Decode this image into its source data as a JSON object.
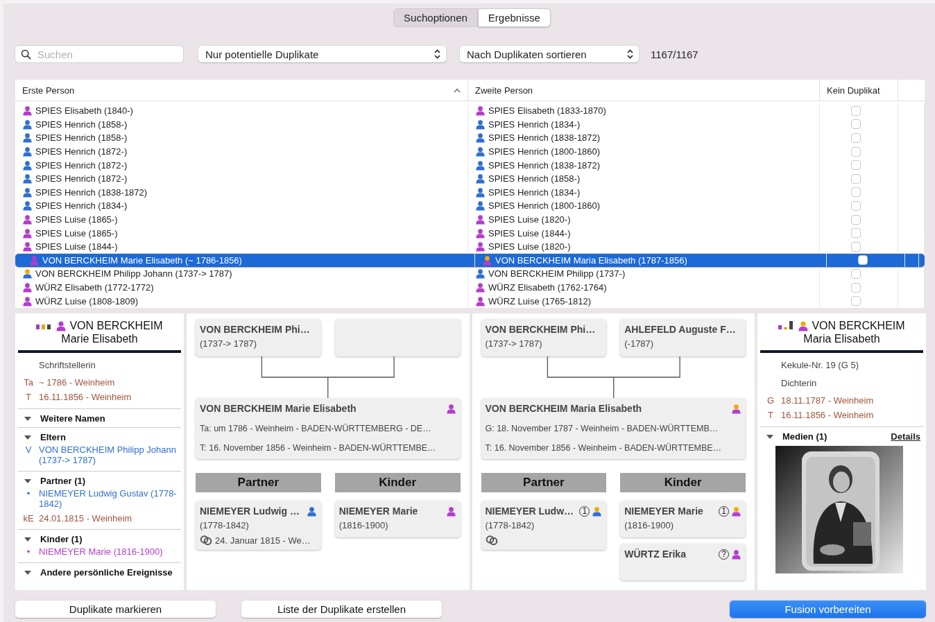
{
  "view_tabs": [
    {
      "label": "Suchoptionen",
      "selected": false
    },
    {
      "label": "Ergebnisse",
      "selected": true
    }
  ],
  "toolbar": {
    "search": {
      "placeholder": "Suchen"
    },
    "filter": "Nur potentielle Duplikate",
    "sort": "Nach Duplikaten sortieren",
    "count": "1167/1167"
  },
  "table": {
    "columns": [
      {
        "label": "Erste Person",
        "sorted": true
      },
      {
        "label": "Zweite Person",
        "sorted": false
      },
      {
        "label": "Kein Duplikat",
        "sorted": false
      }
    ],
    "rows": [
      {
        "first": {
          "text": "SPIES Elisabeth (1840-)",
          "female": true,
          "highlighted": false
        },
        "second": {
          "text": "SPIES Elisabeth (1833-1870)",
          "female": true,
          "highlighted": false
        },
        "checked": false,
        "selected": false
      },
      {
        "first": {
          "text": "SPIES Henrich (1858-)",
          "female": false,
          "highlighted": false
        },
        "second": {
          "text": "SPIES Henrich (1834-)",
          "female": false,
          "highlighted": false
        },
        "checked": false,
        "selected": false
      },
      {
        "first": {
          "text": "SPIES Henrich (1858-)",
          "female": false,
          "highlighted": false
        },
        "second": {
          "text": "SPIES Henrich (1838-1872)",
          "female": false,
          "highlighted": false
        },
        "checked": false,
        "selected": false
      },
      {
        "first": {
          "text": "SPIES Henrich (1872-)",
          "female": false,
          "highlighted": false
        },
        "second": {
          "text": "SPIES Henrich (1800-1860)",
          "female": false,
          "highlighted": false
        },
        "checked": false,
        "selected": false
      },
      {
        "first": {
          "text": "SPIES Henrich (1872-)",
          "female": false,
          "highlighted": false
        },
        "second": {
          "text": "SPIES Henrich (1838-1872)",
          "female": false,
          "highlighted": false
        },
        "checked": false,
        "selected": false
      },
      {
        "first": {
          "text": "SPIES Henrich (1872-)",
          "female": false,
          "highlighted": false
        },
        "second": {
          "text": "SPIES Henrich (1858-)",
          "female": false,
          "highlighted": false
        },
        "checked": false,
        "selected": false
      },
      {
        "first": {
          "text": "SPIES Henrich (1838-1872)",
          "female": false,
          "highlighted": false
        },
        "second": {
          "text": "SPIES Henrich (1834-)",
          "female": false,
          "highlighted": false
        },
        "checked": false,
        "selected": false
      },
      {
        "first": {
          "text": "SPIES Henrich (1834-)",
          "female": false,
          "highlighted": false
        },
        "second": {
          "text": "SPIES Henrich (1800-1860)",
          "female": false,
          "highlighted": false
        },
        "checked": false,
        "selected": false
      },
      {
        "first": {
          "text": "SPIES Luise (1865-)",
          "female": true,
          "highlighted": false
        },
        "second": {
          "text": "SPIES Luise (1820-)",
          "female": true,
          "highlighted": false
        },
        "checked": false,
        "selected": false
      },
      {
        "first": {
          "text": "SPIES Luise (1865-)",
          "female": true,
          "highlighted": false
        },
        "second": {
          "text": "SPIES Luise (1844-)",
          "female": true,
          "highlighted": false
        },
        "checked": false,
        "selected": false
      },
      {
        "first": {
          "text": "SPIES Luise (1844-)",
          "female": true,
          "highlighted": false
        },
        "second": {
          "text": "SPIES Luise (1820-)",
          "female": true,
          "highlighted": false
        },
        "checked": false,
        "selected": false
      },
      {
        "first": {
          "text": "VON BERCKHEIM Marie Elisabeth (~ 1786-1856)",
          "female": true,
          "highlighted": false
        },
        "second": {
          "text": "VON BERCKHEIM Maria Elisabeth (1787-1856)",
          "female": true,
          "highlighted": true
        },
        "checked": false,
        "selected": true
      },
      {
        "first": {
          "text": "VON BERCKHEIM Philipp Johann (1737-> 1787)",
          "female": false,
          "highlighted": true
        },
        "second": {
          "text": "VON BERCKHEIM Philipp (1737-)",
          "female": false,
          "highlighted": false
        },
        "checked": false,
        "selected": false
      },
      {
        "first": {
          "text": "WÜRZ Elisabeth (1772-1772)",
          "female": true,
          "highlighted": false
        },
        "second": {
          "text": "WÜRZ Elisabeth (1762-1764)",
          "female": true,
          "highlighted": false
        },
        "checked": false,
        "selected": false
      },
      {
        "first": {
          "text": "WÜRZ Luise (1808-1809)",
          "female": true,
          "highlighted": false
        },
        "second": {
          "text": "WÜRZ Luise (1765-1812)",
          "female": true,
          "highlighted": false
        },
        "checked": false,
        "selected": false
      }
    ]
  },
  "left_details": {
    "kind": "squares",
    "person": {
      "surname": "VON BERCKHEIM",
      "given": "Marie Elisabeth",
      "female": true,
      "highlighted": false
    },
    "facts": [
      {
        "kind": "note",
        "text": "Schriftstellerin"
      },
      {
        "kind": "event",
        "tag": "Ta",
        "text": "~ 1786 - Weinheim"
      },
      {
        "kind": "event",
        "tag": "T",
        "text": "16.11.1856 - Weinheim"
      }
    ],
    "sections": [
      {
        "title": "Weitere Namen",
        "expanded": true
      },
      {
        "title": "Eltern",
        "expanded": true,
        "items": [
          {
            "kind": "link",
            "tag": "V",
            "text": "VON BERCKHEIM Philipp Johann (1737-> 1787)",
            "female": false
          }
        ]
      },
      {
        "title": "Partner (1)",
        "expanded": true,
        "items": [
          {
            "kind": "link",
            "tag": "•",
            "text": "NIEMEYER Ludwig Gustav (1778-1842)",
            "female": false
          },
          {
            "kind": "event",
            "tag": "kE",
            "text": "24.01.1815 - Weinheim"
          }
        ]
      },
      {
        "title": "Kinder (1)",
        "expanded": true,
        "items": [
          {
            "kind": "link",
            "tag": "•",
            "text": "NIEMEYER Marie (1816-1900)",
            "female": true
          }
        ]
      },
      {
        "title": "Andere persönliche Ereignisse",
        "expanded": true
      }
    ]
  },
  "left_tree": {
    "parents": [
      {
        "kind": "person",
        "name": "VON BERCKHEIM Phi…",
        "years": "(1737-> 1787)"
      },
      {
        "kind": "empty"
      }
    ],
    "main": {
      "name": "VON BERCKHEIM Marie Elisabeth",
      "female": true,
      "highlighted": false,
      "lines": [
        "Ta: um 1786 - Weinheim - BADEN-WÜRTTEMBERG - DE…",
        "T: 16. November 1856 - Weinheim - BADEN-WÜRTTEMBE…"
      ]
    },
    "partner_heading": "Partner",
    "children_heading": "Kinder",
    "partners": [
      {
        "name": "NIEMEYER Ludwig …",
        "years": "(1778-1842)",
        "female": false,
        "highlighted": false,
        "married": true,
        "marriage": "24. Januar 1815 - We…"
      }
    ],
    "children": [
      {
        "name": "NIEMEYER Marie",
        "years": "(1816-1900)",
        "female": true,
        "highlighted": false,
        "married": false
      }
    ]
  },
  "right_tree": {
    "parents": [
      {
        "kind": "person",
        "name": "VON BERCKHEIM Phi…",
        "years": "(1737-> 1787)"
      },
      {
        "kind": "person",
        "name": "AHLEFELD Auguste F…",
        "years": "(-1787)"
      }
    ],
    "main": {
      "name": "VON BERCKHEIM Maria Elisabeth",
      "female": true,
      "highlighted": true,
      "lines": [
        "G: 18. November 1787 - Weinheim - BADEN-WÜRTTEMB…",
        "T: 16. November 1856 - Weinheim - BADEN-WÜRTTEMBE…"
      ]
    },
    "partner_heading": "Partner",
    "children_heading": "Kinder",
    "partners": [
      {
        "name": "NIEMEYER Ludw…",
        "years": "(1778-1842)",
        "female": false,
        "highlighted": true,
        "badge": "1",
        "married": true
      }
    ],
    "children": [
      {
        "name": "NIEMEYER Marie",
        "years": "(1816-1900)",
        "female": true,
        "highlighted": true,
        "badge": "1",
        "married": false
      },
      {
        "name": "WÜRTZ Erika",
        "female": true,
        "highlighted": false,
        "badge": "?",
        "married": false
      }
    ]
  },
  "right_details": {
    "kind": "steps",
    "person": {
      "surname": "VON BERCKHEIM",
      "given": "Maria Elisabeth",
      "female": true,
      "highlighted": true
    },
    "facts": [
      {
        "kind": "note",
        "text": "Kekule-Nr. 19 (G 5)"
      },
      {
        "kind": "note",
        "text": "Dichterin"
      },
      {
        "kind": "event",
        "tag": "G",
        "text": "18.11.1787 - Weinheim"
      },
      {
        "kind": "event",
        "tag": "T",
        "text": "16.11.1856 - Weinheim"
      }
    ],
    "sections": [
      {
        "title": "Medien (1)",
        "expanded": true,
        "action": "Details"
      }
    ]
  },
  "buttons": [
    {
      "label": "Duplikate markieren",
      "primary": false
    },
    {
      "label": "Liste der Duplikate erstellen",
      "primary": false
    },
    {
      "label": "Fusion vorbereiten",
      "primary": true
    }
  ]
}
